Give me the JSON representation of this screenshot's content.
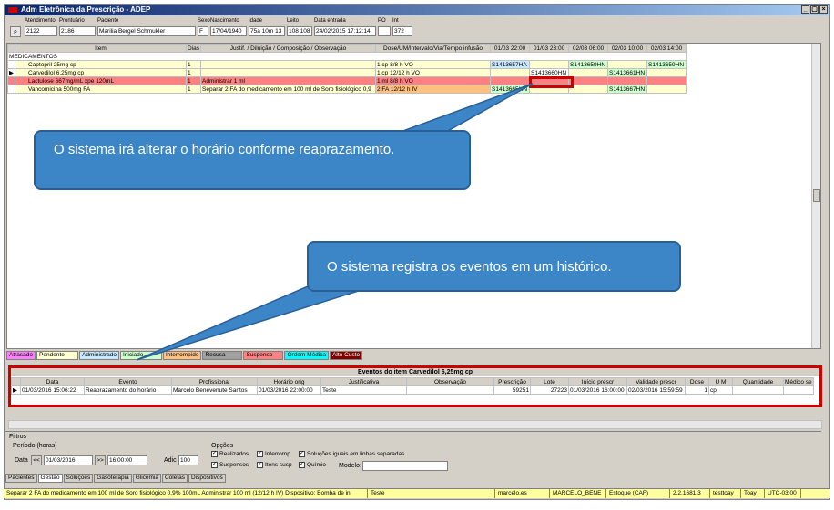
{
  "window": {
    "title": "Adm Eletrônica da Prescrição - ADEP",
    "buttons": [
      "_",
      "▢",
      "×"
    ]
  },
  "patient": {
    "labels": [
      "Atendimento",
      "Prontuário",
      "Paciente",
      "Sexo",
      "Nascimento",
      "Idade",
      "Leito",
      "Data entrada",
      "PO",
      "Int"
    ],
    "values": [
      "2122",
      "2186",
      "Marilia Bergel Schmukler",
      "F",
      "17/04/1940",
      "75a 10m 13",
      "108 108",
      "24/02/2015 17:12:14",
      "",
      "372"
    ]
  },
  "grid": {
    "columns": [
      "",
      "Item",
      "Dias",
      "Justif. / Diluição / Composição / Observação",
      "Dose/UM/Intervalo/Via/Tempo infusão",
      "01/03 22:00",
      "01/03 23:00",
      "02/03 06:00",
      "02/03 10:00",
      "02/03 14:00"
    ],
    "section": "MEDICAMENTOS",
    "rows": [
      {
        "marker": "",
        "item": "Captopril 25mg cp",
        "dias": "1",
        "justif": "",
        "dose": "1 cp  8/8 h  VO",
        "c1": "S1413657HA",
        "c2": "",
        "c3": "S1413659HN",
        "c4": "",
        "c5": "S1413659HN"
      },
      {
        "marker": "▶",
        "item": "Carvedilol 6,25mg cp",
        "dias": "1",
        "justif": "",
        "dose": "1 cp  12/12 h  VO",
        "c1": "",
        "c2": "S1413660HN",
        "c3": "",
        "c4": "S1413661HN",
        "c5": ""
      },
      {
        "marker": "",
        "item": "Lactulose 667mg/mL xpe 120mL",
        "dias": "1",
        "justif": "Administrar 1 ml",
        "dose": "1 ml  8/8 h  VO",
        "c1": "",
        "c2": "",
        "c3": "",
        "c4": "",
        "c5": ""
      },
      {
        "marker": "",
        "item": "Vancomicina 500mg FA",
        "dias": "1",
        "justif": "Separar 2 FA do medicamento em 100 ml de Soro fisiológico 0,9",
        "dose": "2 FA  12/12 h  IV",
        "c1": "S1413665HN",
        "c2": "",
        "c3": "",
        "c4": "S1413667HN",
        "c5": ""
      }
    ]
  },
  "legend": [
    "Atrasado",
    "Pendente",
    "Administrado",
    "Iniciado",
    "Interrompido",
    "Recusa",
    "Suspenso",
    "Ordem Médica",
    "Alto Custo"
  ],
  "events": {
    "title": "Eventos do item Carvedilol 6,25mg cp",
    "columns": [
      "",
      "Data",
      "Evento",
      "Profissional",
      "Horário orig",
      "Justificativa",
      "Observação",
      "Prescrição",
      "Lote",
      "Início prescr",
      "Validade prescr",
      "Dose",
      "U M",
      "Quantidade",
      "Médico se"
    ],
    "rows": [
      {
        "marker": "▶",
        "data": "01/03/2016 15:06:22",
        "evento": "Reaprazamento do horário",
        "profissional": "Marcelo Benevenute Santos",
        "horario": "01/03/2016 22:00:00",
        "justif": "Teste",
        "obs": "",
        "prescricao": "59251",
        "lote": "27223",
        "inicio": "01/03/2016 16:00:00",
        "validade": "02/03/2016 15:59:59",
        "dose": "1",
        "um": "cp",
        "quantidade": "",
        "medico": ""
      }
    ]
  },
  "filters": {
    "title": "Filtros",
    "period_label": "Período (horas)",
    "date_label": "Data",
    "date_value": "01/03/2016",
    "time_value": "16:00:00",
    "prev": "<<",
    "next": ">>",
    "adic_label": "Adic",
    "adic_value": "100",
    "options_label": "Opções",
    "options": [
      {
        "label": "Realizados",
        "checked": true
      },
      {
        "label": "Interromp",
        "checked": true
      },
      {
        "label": "Soluções iguais em linhas separadas",
        "checked": true
      },
      {
        "label": "Suspensos",
        "checked": true
      },
      {
        "label": "Itens susp",
        "checked": true
      },
      {
        "label": "Químio",
        "checked": true
      }
    ],
    "modelo_label": "Modelo:",
    "modelo_value": ""
  },
  "tabs": [
    "Pacientes",
    "Gestão",
    "Soluções",
    "Gasoterapia",
    "Glicemia",
    "Coletas",
    "Dispositivos"
  ],
  "active_tab": "Gestão",
  "status": [
    "Separar 2 FA do medicamento em 100 ml de Soro fisiológico 0,9% 100mL  Administrar 100 ml (12/12 h IV)  Dispositivo: Bomba de in",
    "Teste",
    "marcelo.es",
    "MARCELO_BENE",
    "Estoque (CAF)",
    "2.2.1681.3",
    "testtoay",
    "Toay",
    "UTC-03:00"
  ],
  "callouts": {
    "top": "O sistema irá alterar o horário conforme reaprazamento.",
    "bottom": "O sistema registra os eventos em um histórico."
  },
  "colors": {
    "accent_red": "#cc0000",
    "callout_blue": "#3c86c8",
    "highlight_row": "#ff8080",
    "pending_cell": "#ccffcc",
    "schedule_cell": "#c8e8ff"
  }
}
